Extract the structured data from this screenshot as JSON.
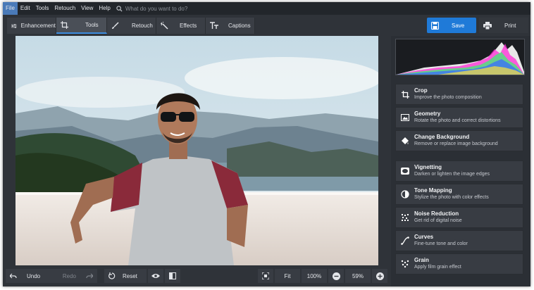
{
  "menu": {
    "items": [
      "File",
      "Edit",
      "Tools",
      "Retouch",
      "View",
      "Help"
    ],
    "search_placeholder": "What do you want to do?"
  },
  "tabs": [
    {
      "label": "Enhancement",
      "icon": "sliders-icon"
    },
    {
      "label": "Tools",
      "icon": "crop-icon"
    },
    {
      "label": "Retouch",
      "icon": "brush-icon"
    },
    {
      "label": "Effects",
      "icon": "magic-wand-icon"
    },
    {
      "label": "Captions",
      "icon": "text-icon"
    }
  ],
  "actions": {
    "save_label": "Save",
    "print_label": "Print"
  },
  "tools": [
    {
      "title": "Crop",
      "subtitle": "Improve the photo composition",
      "icon": "crop-icon"
    },
    {
      "title": "Geometry",
      "subtitle": "Rotate the photo and correct distortions",
      "icon": "geometry-icon"
    },
    {
      "title": "Change Background",
      "subtitle": "Remove or replace image background",
      "icon": "paint-bucket-icon"
    },
    {
      "title": "Vignetting",
      "subtitle": "Darken or lighten the image edges",
      "icon": "vignette-icon"
    },
    {
      "title": "Tone Mapping",
      "subtitle": "Stylize the photo with color effects",
      "icon": "tone-mapping-icon"
    },
    {
      "title": "Noise Reduction",
      "subtitle": "Get rid of digital noise",
      "icon": "noise-icon"
    },
    {
      "title": "Curves",
      "subtitle": "Fine-tune tone and color",
      "icon": "curves-icon"
    },
    {
      "title": "Grain",
      "subtitle": "Apply film grain effect",
      "icon": "grain-icon"
    }
  ],
  "bottom": {
    "undo_label": "Undo",
    "redo_label": "Redo",
    "reset_label": "Reset",
    "fit_label": "Fit",
    "zoom_100_label": "100%",
    "zoom_value": "59%"
  },
  "colors": {
    "accent": "#1f7ad8",
    "tab_active_underline": "#3c8de0",
    "panel_bg": "#2f3339"
  }
}
